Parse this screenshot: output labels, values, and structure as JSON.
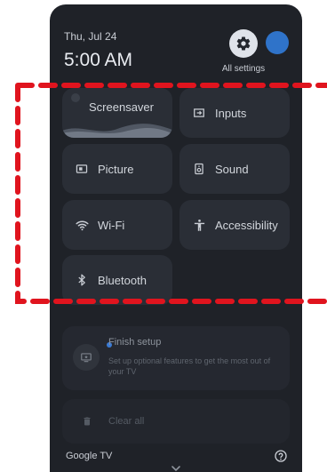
{
  "header": {
    "date": "Thu, Jul 24",
    "time": "5:00 AM",
    "settings_label": "All settings"
  },
  "tiles": {
    "screensaver": "Screensaver",
    "inputs": "Inputs",
    "picture": "Picture",
    "sound": "Sound",
    "wifi": "Wi-Fi",
    "accessibility": "Accessibility",
    "bluetooth": "Bluetooth"
  },
  "notification": {
    "title": "Finish setup",
    "body": "Set up optional features to get the most out of your TV"
  },
  "clear_all_label": "Clear all",
  "footer": {
    "brand": "Google TV"
  },
  "icons": {
    "settings": "gear-icon",
    "inputs": "input-icon",
    "picture": "picture-icon",
    "sound": "speaker-icon",
    "wifi": "wifi-icon",
    "accessibility": "accessibility-icon",
    "bluetooth": "bluetooth-icon",
    "notification": "tv-setup-icon",
    "clear": "trash-icon",
    "help": "help-icon",
    "chevron": "chevron-down-icon"
  },
  "colors": {
    "panel": "#1f2228",
    "tile": "#2a2e36",
    "accent": "#2f73c9",
    "callout": "#e0141e"
  }
}
